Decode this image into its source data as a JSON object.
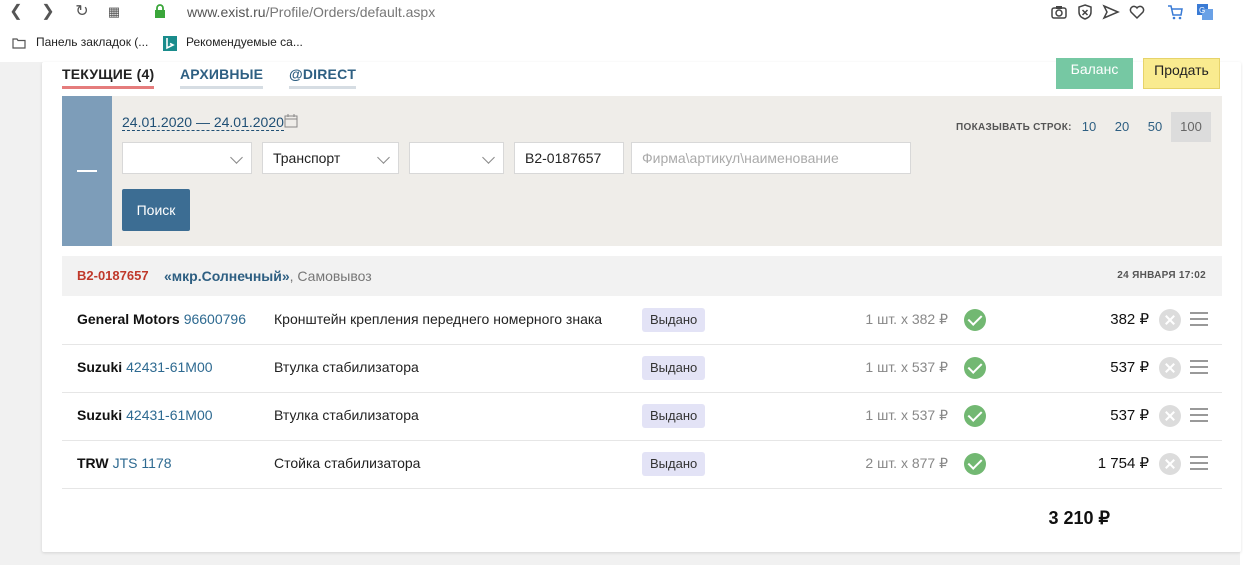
{
  "browser": {
    "url_host": "www.exist.ru",
    "url_path": "/Profile/Orders/default.aspx",
    "bookmarks": [
      "Панель закладок (...",
      "Рекомендуемые са..."
    ]
  },
  "tabs": [
    {
      "label": "ТЕКУЩИЕ (4)",
      "active": true
    },
    {
      "label": "АРХИВНЫЕ",
      "active": false
    },
    {
      "label": "@DIRECT",
      "active": false
    }
  ],
  "actions": {
    "balance": "Баланс",
    "sell": "Продать"
  },
  "filter": {
    "date_range": "24.01.2020 — 24.01.2020",
    "select1": "",
    "select2": "Транспорт",
    "select3": "",
    "order_number": "B2-0187657",
    "search_placeholder": "Фирма\\артикул\\наименование",
    "search_button": "Поиск",
    "rows_label": "ПОКАЗЫВАТЬ СТРОК:",
    "rows_options": [
      "10",
      "20",
      "50",
      "100"
    ],
    "rows_selected": "100"
  },
  "order": {
    "id": "B2-0187657",
    "place": "«мкр.Солнечный»",
    "delivery": ", Самовывоз",
    "date": "24 ЯНВАРЯ 17:02",
    "items": [
      {
        "brand": "General Motors",
        "article": "96600796",
        "name": "Кронштейн крепления переднего номерного знака",
        "status": "Выдано",
        "qty": "1 шт. x 382 ₽",
        "sum": "382 ₽"
      },
      {
        "brand": "Suzuki",
        "article": "42431-61M00",
        "name": "Втулка стабилизатора",
        "status": "Выдано",
        "qty": "1 шт. x 537 ₽",
        "sum": "537 ₽"
      },
      {
        "brand": "Suzuki",
        "article": "42431-61M00",
        "name": "Втулка стабилизатора",
        "status": "Выдано",
        "qty": "1 шт. x 537 ₽",
        "sum": "537 ₽"
      },
      {
        "brand": "TRW",
        "article": "JTS 1178",
        "name": "Стойка стабилизатора",
        "status": "Выдано",
        "qty": "2 шт. x 877 ₽",
        "sum": "1 754 ₽"
      }
    ],
    "total": "3 210 ₽"
  }
}
